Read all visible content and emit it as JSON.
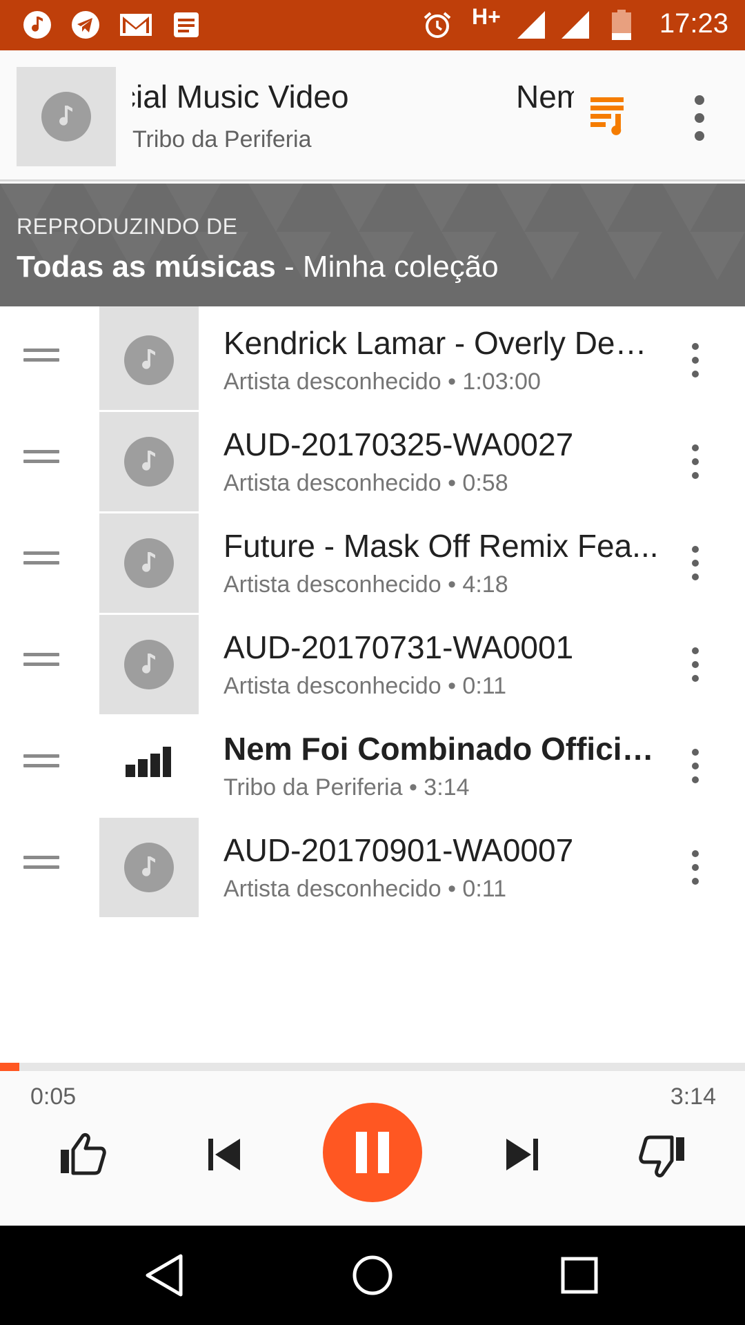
{
  "status_bar": {
    "time": "17:23",
    "network": "H+",
    "left_icons": [
      "music-note-icon",
      "telegram-icon",
      "gmail-icon",
      "notes-icon"
    ],
    "right_icons": [
      "alarm-icon",
      "signal-icon",
      "signal-icon",
      "battery-low-icon"
    ]
  },
  "now_playing": {
    "title_visible": "cial Music Video",
    "title_next_visible": "Nem",
    "artist": "Tribo da Periferia"
  },
  "banner": {
    "label": "REPRODUZINDO DE",
    "source_bold": "Todas as músicas",
    "source_rest": " - Minha coleção"
  },
  "queue": [
    {
      "title": "Kendrick Lamar - Overly Dedi...",
      "subtitle": "Artista desconhecido • 1:03:00",
      "playing": false
    },
    {
      "title": "AUD-20170325-WA0027",
      "subtitle": "Artista desconhecido • 0:58",
      "playing": false
    },
    {
      "title": "Future - Mask Off Remix Fea...",
      "subtitle": "Artista desconhecido • 4:18",
      "playing": false
    },
    {
      "title": "AUD-20170731-WA0001",
      "subtitle": "Artista desconhecido • 0:11",
      "playing": false
    },
    {
      "title": "Nem Foi Combinado Official...",
      "subtitle": "Tribo da Periferia • 3:14",
      "playing": true
    },
    {
      "title": "AUD-20170901-WA0007",
      "subtitle": "Artista desconhecido • 0:11",
      "playing": false
    }
  ],
  "player": {
    "elapsed": "0:05",
    "total": "3:14",
    "progress": 0.026
  },
  "colors": {
    "status_bar": "#bf3f0a",
    "accent": "#ff5722",
    "queue_icon": "#f57c00",
    "banner": "#6b6b6b"
  }
}
